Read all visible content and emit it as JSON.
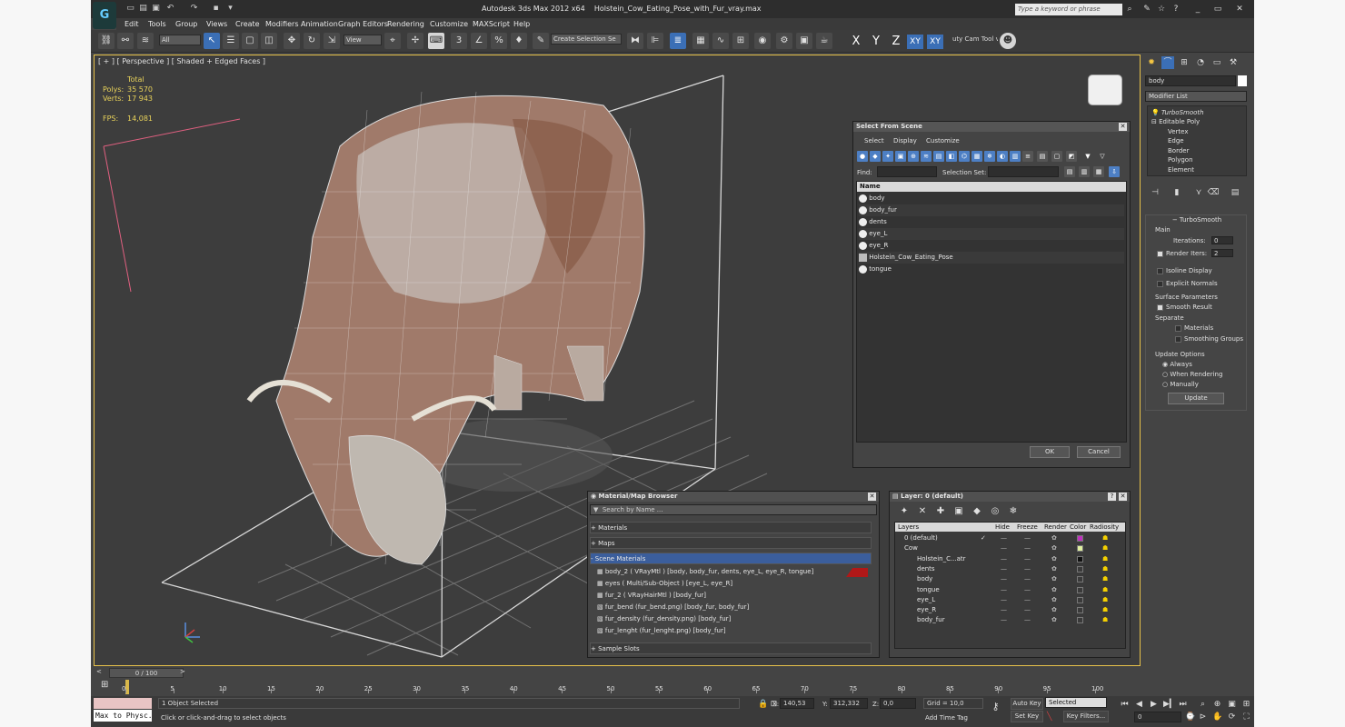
{
  "app": {
    "title": "Autodesk 3ds Max  2012 x64",
    "file": "Holstein_Cow_Eating_Pose_with_Fur_vray.max",
    "logo": "3ds-max-logo",
    "search_placeholder": "Type a keyword or phrase"
  },
  "menu": [
    "Edit",
    "Tools",
    "Group",
    "Views",
    "Create",
    "Modifiers",
    "Animation",
    "Graph Editors",
    "Rendering",
    "Customize",
    "MAXScript",
    "Help"
  ],
  "toolbar": {
    "filter": "All",
    "refcoord": "View",
    "selection_set": "Create Selection Se",
    "axis": [
      "X",
      "Y",
      "Z",
      "XY",
      "XY"
    ],
    "custom_tool": "uty Cam Tool v"
  },
  "viewport": {
    "label": "[ + ] [ Perspective ] [ Shaded + Edged Faces ]",
    "stats": {
      "total_label": "Total",
      "polys_label": "Polys:",
      "polys": "35 570",
      "verts_label": "Verts:",
      "verts": "17 943",
      "fps_label": "FPS:",
      "fps": "14,081"
    }
  },
  "command_panel": {
    "name_field": "body",
    "modifier_list": "Modifier List",
    "stack": [
      "TurboSmooth",
      "Editable Poly",
      "Vertex",
      "Edge",
      "Border",
      "Polygon",
      "Element"
    ],
    "turbosmooth": {
      "title": "TurboSmooth",
      "main": "Main",
      "iterations_label": "Iterations:",
      "iterations": "0",
      "render_iters_label": "Render Iters:",
      "render_iters": "2",
      "isoline": "Isoline Display",
      "explicit_normals": "Explicit Normals",
      "surface_params": "Surface Parameters",
      "smooth_result": "Smooth Result",
      "separate": "Separate",
      "materials": "Materials",
      "smoothing_groups": "Smoothing Groups",
      "update_options": "Update Options",
      "always": "Always",
      "when_rendering": "When Rendering",
      "manually": "Manually",
      "update_btn": "Update"
    }
  },
  "select_from_scene": {
    "title": "Select From Scene",
    "menu": [
      "Select",
      "Display",
      "Customize"
    ],
    "find_label": "Find:",
    "selection_set_label": "Selection Set:",
    "column": "Name",
    "items": [
      "body",
      "body_fur",
      "dents",
      "eye_L",
      "eye_R",
      "Holstein_Cow_Eating_Pose",
      "tongue"
    ],
    "ok": "OK",
    "cancel": "Cancel"
  },
  "material_browser": {
    "title": "Material/Map Browser",
    "search": "Search by Name ...",
    "groups": [
      "+ Materials",
      "+ Maps",
      "- Scene Materials",
      "+ Sample Slots"
    ],
    "items": [
      "body_2  ( VRayMtl ) [body, body_fur, dents, eye_L, eye_R, tongue]",
      "eyes  ( Multi/Sub-Object ) [eye_L, eye_R]",
      "fur_2  ( VRayHairMtl ) [body_fur]",
      "fur_bend (fur_bend.png) [body_fur, body_fur]",
      "fur_density (fur_density.png) [body_fur]",
      "fur_lenght (fur_lenght.png) [body_fur]"
    ]
  },
  "layer_manager": {
    "title": "Layer: 0 (default)",
    "help": "?",
    "columns": [
      "Layers",
      "Hide",
      "Freeze",
      "Render",
      "Color",
      "Radiosity"
    ],
    "rows": [
      {
        "name": "0 (default)",
        "color": "#c030c0"
      },
      {
        "name": "Cow",
        "color": "#e0f0a0"
      },
      {
        "name": "Holstein_C...atr",
        "color": "#111111"
      },
      {
        "name": "dents",
        "color": ""
      },
      {
        "name": "body",
        "color": ""
      },
      {
        "name": "tongue",
        "color": ""
      },
      {
        "name": "eye_L",
        "color": ""
      },
      {
        "name": "eye_R",
        "color": ""
      },
      {
        "name": "body_fur",
        "color": ""
      }
    ]
  },
  "timeline": {
    "frame": "0 / 100",
    "ticks": [
      "0",
      "5",
      "10",
      "15",
      "20",
      "25",
      "30",
      "35",
      "40",
      "45",
      "50",
      "55",
      "60",
      "65",
      "70",
      "75",
      "80",
      "85",
      "90",
      "95",
      "100"
    ]
  },
  "status": {
    "script_listener": "Max to Physc.",
    "selected": "1 Object Selected",
    "prompt": "Click or click-and-drag to select objects",
    "x_label": "X:",
    "x": "140,53",
    "y_label": "Y:",
    "y": "312,332",
    "z_label": "Z:",
    "z": "0,0",
    "grid": "Grid = 10,0",
    "add_time_tag": "Add Time Tag",
    "auto_key": "Auto Key",
    "set_key": "Set Key",
    "key_mode": "Selected",
    "key_filters": "Key Filters...",
    "frame_field": "0"
  }
}
